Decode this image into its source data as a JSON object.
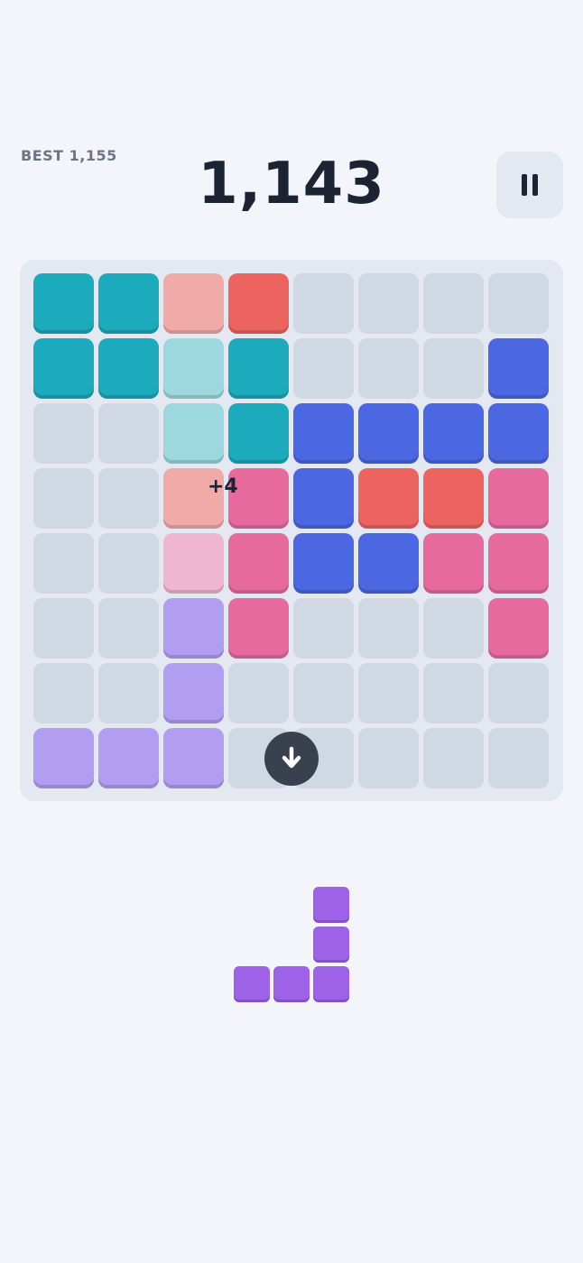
{
  "header": {
    "best_label": "BEST 1,155",
    "score": "1,143",
    "pause_icon": "pause-icon"
  },
  "board": {
    "rows": 8,
    "cols": 8,
    "colors": {
      "teal": "#1cabbd",
      "peach": "#f0aaa8",
      "coral": "#ec6360",
      "aqua": "#9dd8df",
      "blue": "#4b67e2",
      "pink": "#e66a9c",
      "lightpink": "#f0b6cf",
      "lavender": "#b29ef0"
    },
    "cells": [
      [
        "teal",
        "teal",
        "peach",
        "coral",
        null,
        null,
        null,
        null
      ],
      [
        "teal",
        "teal",
        "aqua",
        "teal",
        null,
        null,
        null,
        "blue"
      ],
      [
        null,
        null,
        "aqua",
        "teal",
        "blue",
        "blue",
        "blue",
        "blue"
      ],
      [
        null,
        null,
        "peach",
        "pink",
        "blue",
        "coral",
        "coral",
        "pink"
      ],
      [
        null,
        null,
        "lightpink",
        "pink",
        "blue",
        "blue",
        "pink",
        "pink"
      ],
      [
        null,
        null,
        "lavender",
        "pink",
        null,
        null,
        null,
        "pink"
      ],
      [
        null,
        null,
        "lavender",
        null,
        null,
        null,
        null,
        null
      ],
      [
        "lavender",
        "lavender",
        "lavender",
        null,
        null,
        null,
        null,
        null
      ]
    ],
    "score_popup": "+4",
    "drop_icon": "arrow-down-icon"
  },
  "next_piece": {
    "color": "#9d62e8",
    "blocks": [
      [
        0,
        2
      ],
      [
        1,
        2
      ],
      [
        2,
        0
      ],
      [
        2,
        1
      ],
      [
        2,
        2
      ]
    ]
  }
}
